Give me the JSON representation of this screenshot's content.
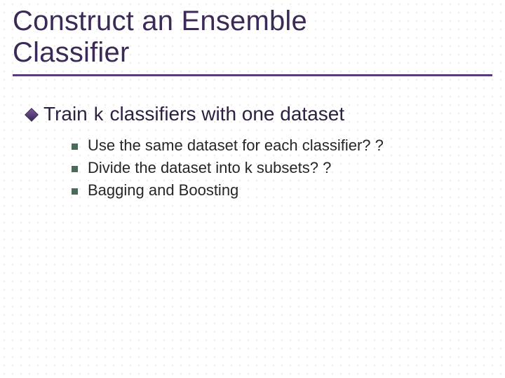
{
  "title_line1": "Construct an Ensemble",
  "title_line2": "Classifier",
  "main": {
    "prefix": "Train ",
    "k": "k",
    "suffix": " classifiers with one dataset"
  },
  "subitems": [
    "Use the same dataset for each classifier? ?",
    "Divide the dataset into k subsets? ?",
    "Bagging and Boosting"
  ]
}
